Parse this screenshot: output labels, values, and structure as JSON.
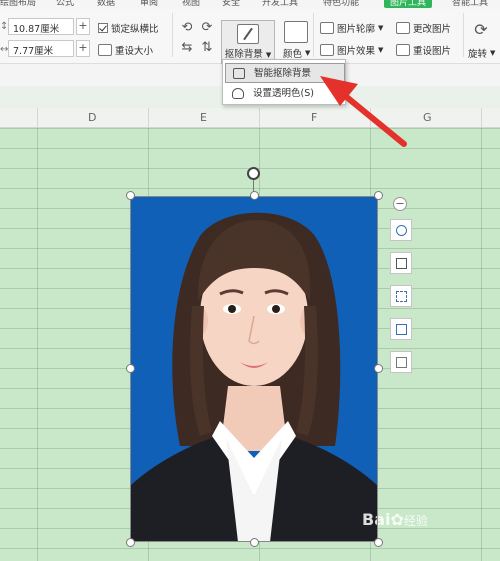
{
  "menu_tabs": [
    "绘图布局",
    "公式",
    "数据",
    "审阅",
    "视图",
    "安全",
    "开发工具",
    "特色功能",
    "图片工具",
    "智能工具"
  ],
  "ribbon": {
    "height_value": "10.87厘米",
    "width_value": "7.77厘米",
    "lock_ratio_label": "锁定纵横比",
    "reset_size_label": "重设大小",
    "remove_bg_label": "抠除背景",
    "color_label": "颜色",
    "picture_outline_label": "图片轮廓",
    "picture_effects_label": "图片效果",
    "change_picture_label": "更改图片",
    "reset_picture_label": "重设图片",
    "rotate_label": "旋转"
  },
  "dropdown": {
    "items": [
      {
        "label": "智能抠除背景",
        "icon": "smart-remove-icon"
      },
      {
        "label": "设置透明色(S)",
        "icon": "transparent-color-icon"
      }
    ]
  },
  "columns": [
    "D",
    "E",
    "F",
    "G"
  ],
  "photo": {
    "background_color": "#1160b8",
    "description_icon": "portrait-photo"
  },
  "float_tools": [
    "zoom-icon",
    "crop-icon",
    "border-icon",
    "change-icon",
    "effects-icon"
  ],
  "watermark": {
    "text": "Bai",
    "suffix": "经验"
  },
  "colors": {
    "accent": "#2fb55a",
    "grid": "#c9e8c9",
    "arrow": "#e4312b"
  }
}
